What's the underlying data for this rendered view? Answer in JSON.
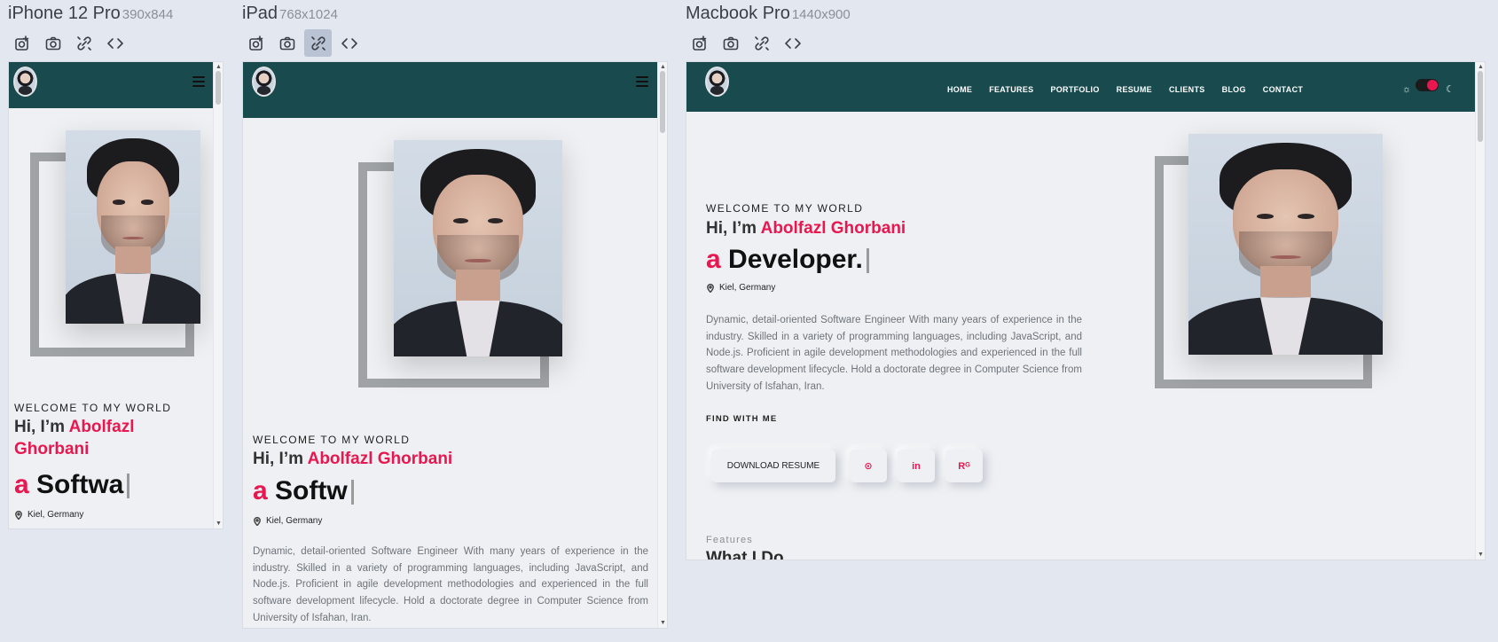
{
  "toolbar_icons": [
    "screenshot-page-icon",
    "camera-icon",
    "link-sync-icon",
    "code-icon"
  ],
  "devices": [
    {
      "name": "iPhone 12 Pro",
      "size": "390x844"
    },
    {
      "name": "iPad",
      "size": "768x1024"
    },
    {
      "name": "Macbook Pro",
      "size": "1440x900"
    }
  ],
  "site": {
    "nav": [
      "HOME",
      "FEATURES",
      "PORTFOLIO",
      "RESUME",
      "CLIENTS",
      "BLOG",
      "CONTACT"
    ],
    "welcome": "WELCOME TO MY WORLD",
    "hi": "Hi, I’m ",
    "name": "Abolfazl Ghorbani",
    "name_line1": "Abolfazl",
    "name_line2": "Ghorbani",
    "role_prefix": "a ",
    "role_iphone": "Softwa",
    "role_ipad": "Softw",
    "role_mac": "Developer.",
    "location": "Kiel, Germany",
    "description": "Dynamic, detail-oriented Software Engineer With many years of experience in the industry. Skilled in a variety of programming languages, including JavaScript, and Node.js. Proficient in agile development methodologies and experienced in the full software development lifecycle. Hold a doctorate degree in Computer Science from University of Isfahan, Iran.",
    "find_with_me": "FIND WITH ME",
    "download_resume": "DOWNLOAD RESUME",
    "social": [
      "github-icon",
      "linkedin-icon",
      "researchgate-icon"
    ],
    "social_glyphs": [
      "⊙",
      "in",
      "Rᴳ"
    ],
    "features_label": "Features",
    "what_i_do": "What I Do"
  },
  "colors": {
    "nav_bg": "#184a4e",
    "accent": "#e8174f"
  },
  "toolbar_active": {
    "ipad": "link-sync-icon"
  }
}
